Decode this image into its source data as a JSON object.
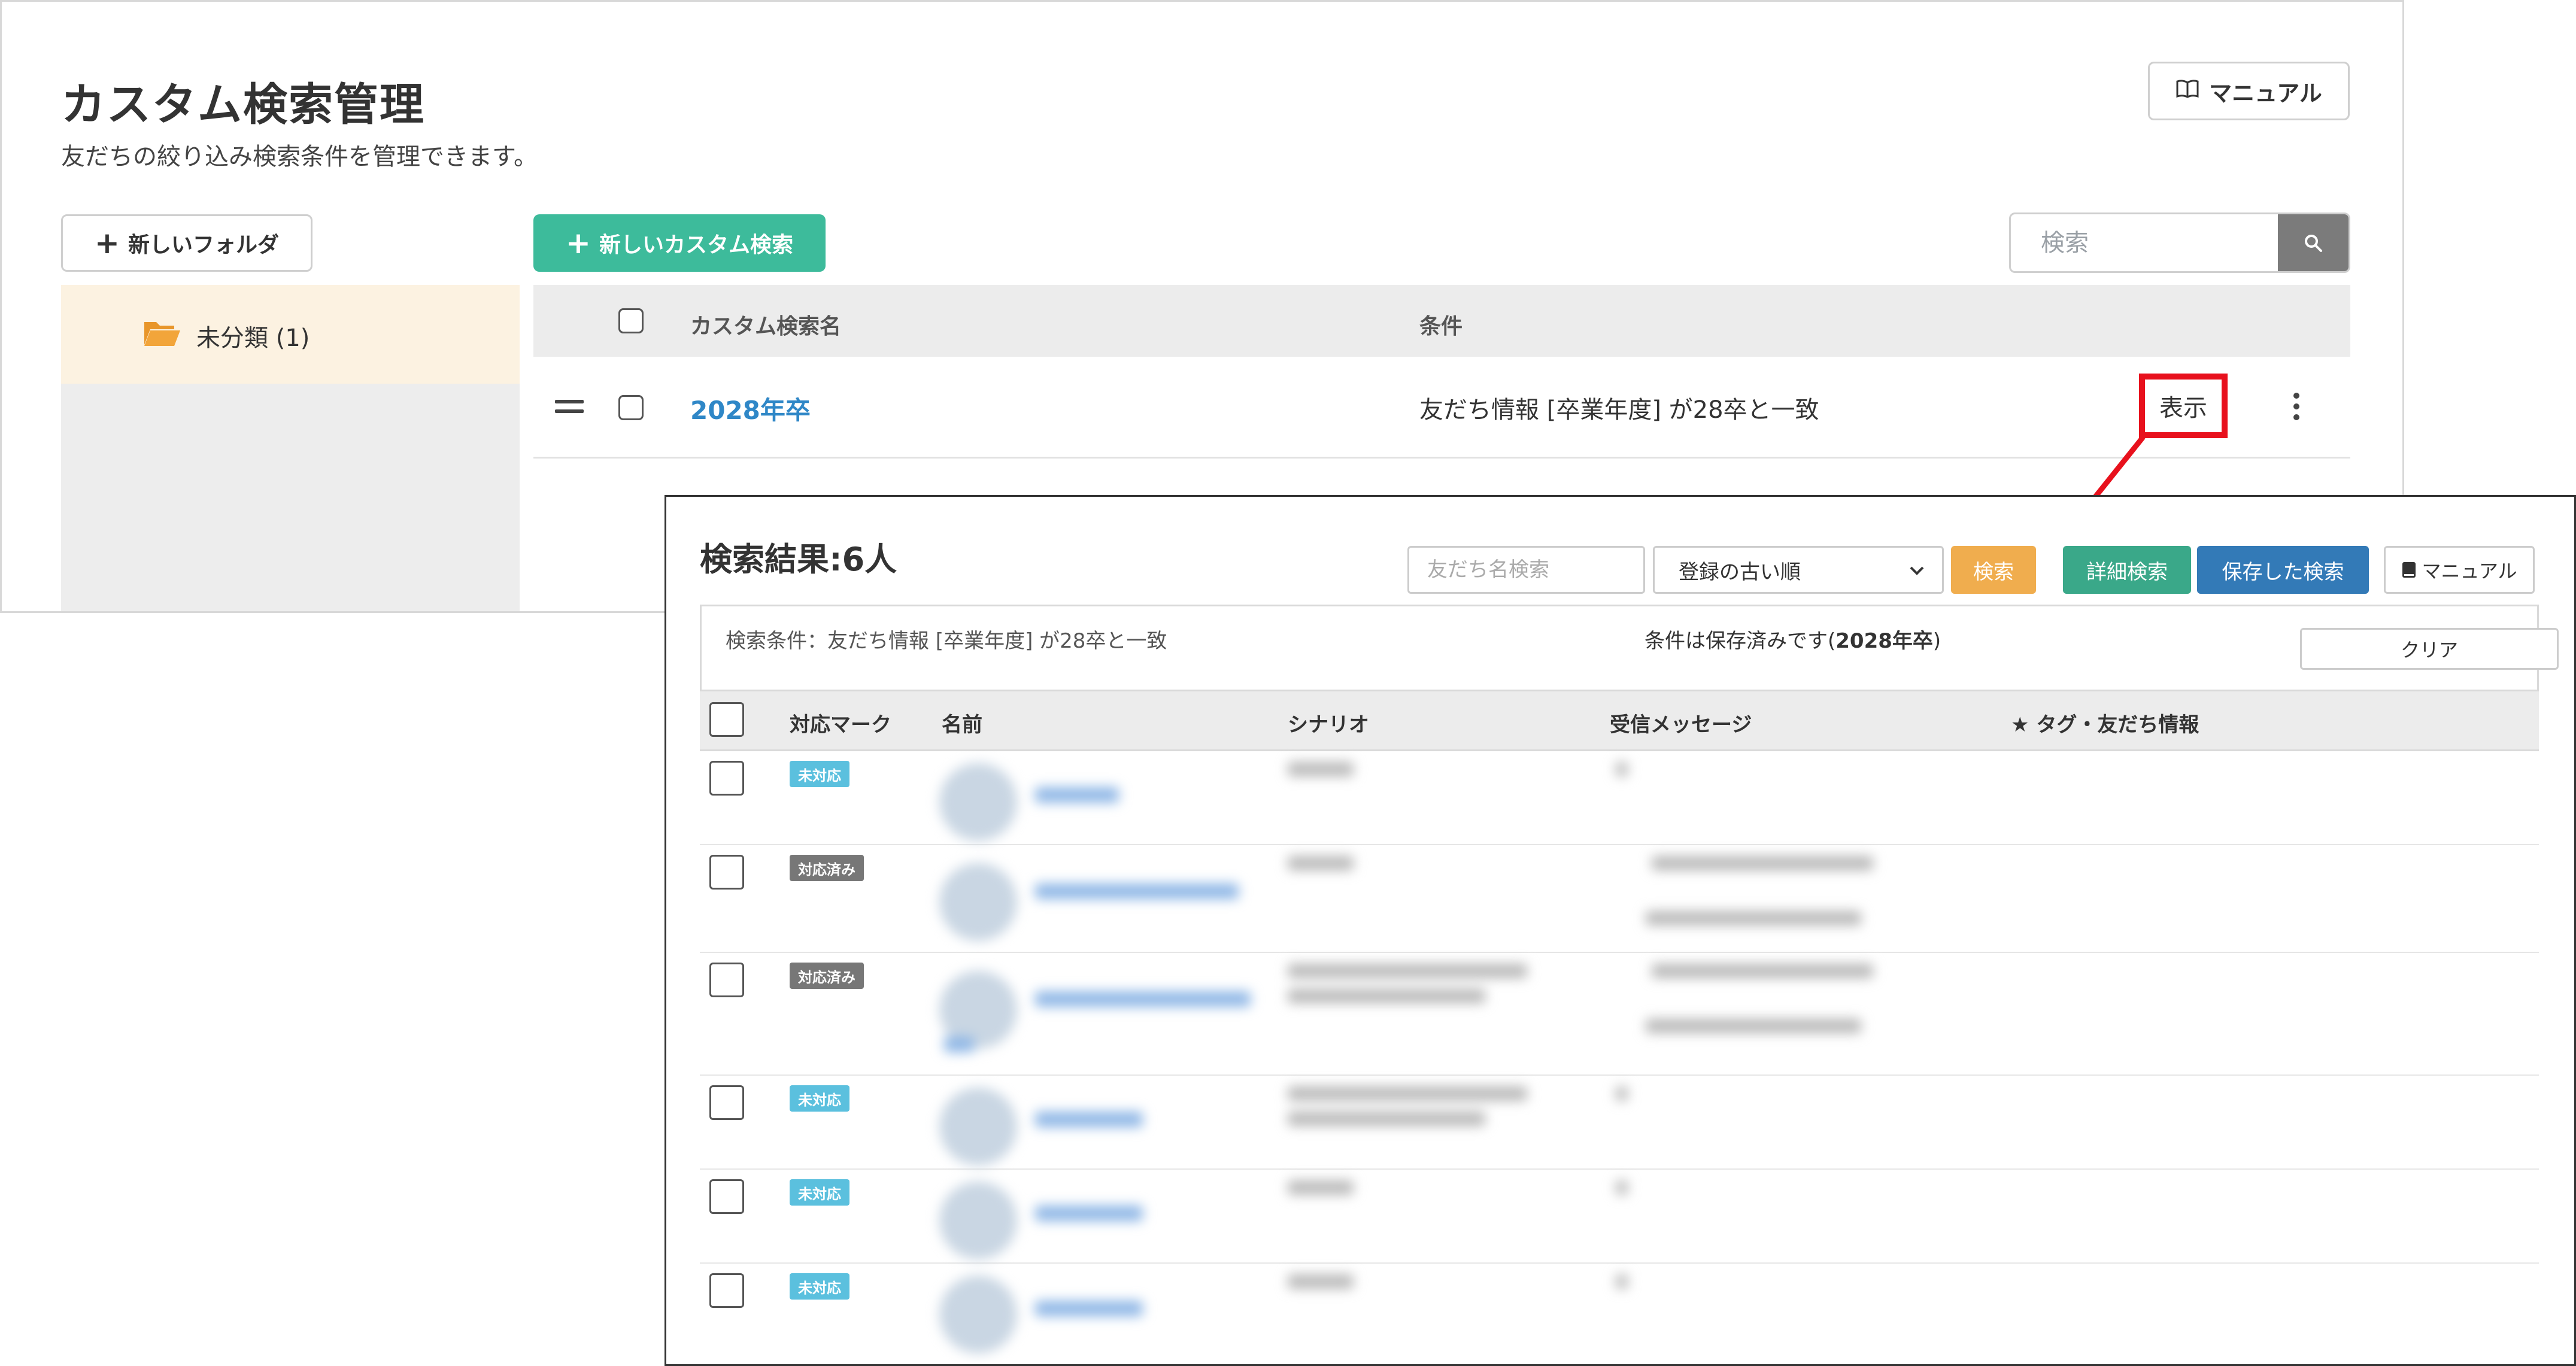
{
  "header": {
    "title": "カスタム検索管理",
    "subtitle": "友だちの絞り込み検索条件を管理できます。",
    "manual_label": "マニュアル"
  },
  "toolbar": {
    "new_folder_label": "新しいフォルダ",
    "new_search_label": "新しいカスタム検索",
    "search_placeholder": "検索"
  },
  "sidebar": {
    "folders": [
      {
        "label": "未分類 (1)"
      }
    ]
  },
  "table": {
    "columns": {
      "name": "カスタム検索名",
      "condition": "条件"
    },
    "rows": [
      {
        "name": "2028年卒",
        "condition": "友だち情報 [卒業年度] が28卒と一致",
        "action": "表示"
      }
    ]
  },
  "result": {
    "title": "検索結果:6人",
    "name_search_placeholder": "友だち名検索",
    "sort_selected": "登録の古い順",
    "search_label": "検索",
    "detail_search_label": "詳細検索",
    "saved_search_label": "保存した検索",
    "manual_label": "マニュアル",
    "condition_text": "検索条件：友だち情報 [卒業年度] が28卒と一致",
    "saved_prefix": "条件は保存済みです(",
    "saved_name": "2028年卒",
    "saved_suffix": ")",
    "clear_label": "クリア",
    "columns": {
      "mark": "対応マーク",
      "name": "名前",
      "scenario": "シナリオ",
      "message": "受信メッセージ",
      "tags": "★ タグ・友だち情報"
    },
    "rows": [
      {
        "status": "未対応",
        "status_type": "unhandled"
      },
      {
        "status": "対応済み",
        "status_type": "handled"
      },
      {
        "status": "対応済み",
        "status_type": "handled"
      },
      {
        "status": "未対応",
        "status_type": "unhandled"
      },
      {
        "status": "未対応",
        "status_type": "unhandled"
      },
      {
        "status": "未対応",
        "status_type": "unhandled"
      }
    ]
  },
  "colors": {
    "accent_green": "#3dbb9b",
    "link_blue": "#2f87c7",
    "highlight_red": "#e8111d",
    "search_orange": "#f0ad4e",
    "saved_blue": "#337ab7"
  }
}
